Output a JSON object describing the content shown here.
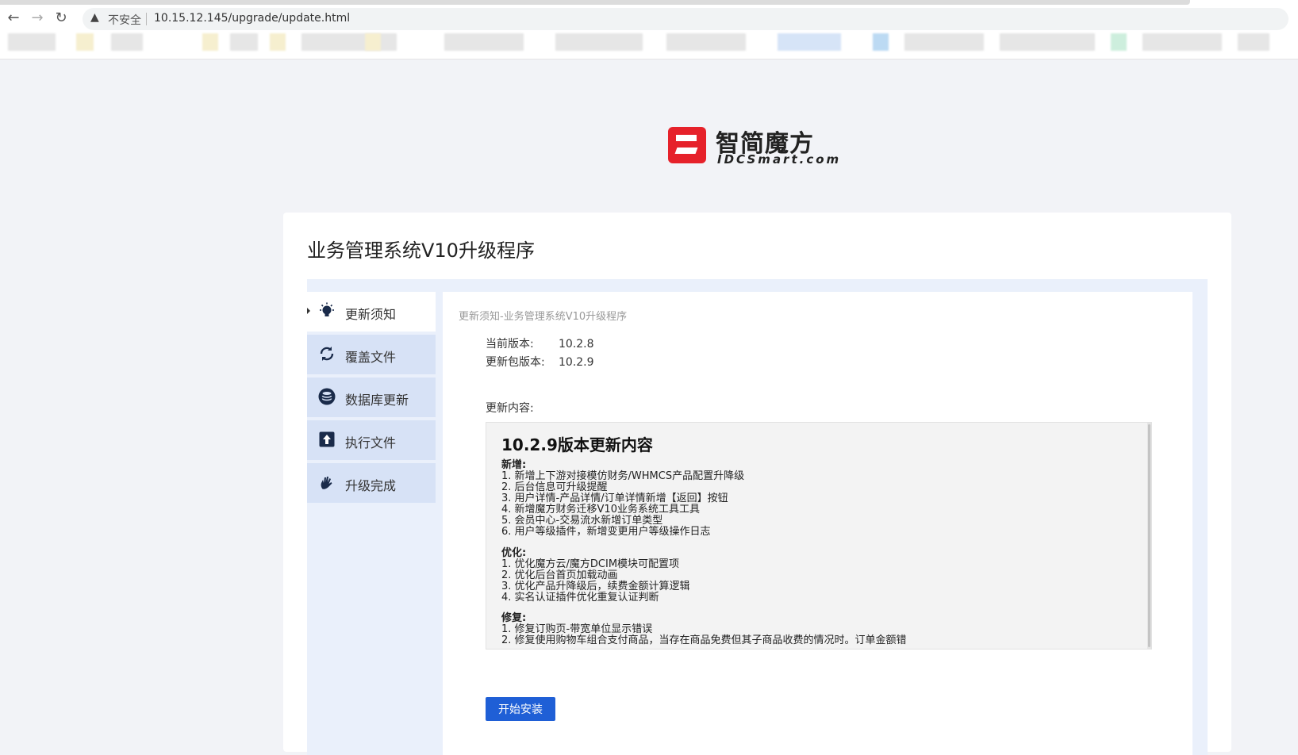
{
  "browser": {
    "insecure_label": "不安全",
    "url": "10.15.12.145/upgrade/update.html",
    "back_icon": "←",
    "forward_icon": "→",
    "reload_icon": "↻",
    "warning_icon": "▲"
  },
  "logo": {
    "name_cn": "智简魔方",
    "name_en": "IDCSmart.com",
    "brand_color": "#e6212a"
  },
  "page": {
    "title": "业务管理系统V10升级程序"
  },
  "steps": [
    {
      "label": "更新须知",
      "icon": "bulb-icon",
      "active": true
    },
    {
      "label": "覆盖文件",
      "icon": "refresh-icon",
      "active": false
    },
    {
      "label": "数据库更新",
      "icon": "database-icon",
      "active": false
    },
    {
      "label": "执行文件",
      "icon": "upload-icon",
      "active": false
    },
    {
      "label": "升级完成",
      "icon": "hand-icon",
      "active": false
    }
  ],
  "content": {
    "breadcrumb": "更新须知-业务管理系统V10升级程序",
    "current_version_label": "当前版本:",
    "current_version": "10.2.8",
    "package_version_label": "更新包版本:",
    "package_version": "10.2.9",
    "notes_label": "更新内容:",
    "notes_title": "10.2.9版本更新内容",
    "sections": [
      {
        "heading": "新增:",
        "items": [
          "1. 新增上下游对接模仿财务/WHMCS产品配置升降级",
          "2. 后台信息可升级提醒",
          "3. 用户详情-产品详情/订单详情新增【返回】按钮",
          "4. 新增魔方财务迁移V10业务系统工具工具",
          "5. 会员中心-交易流水新增订单类型",
          "6. 用户等级插件，新增变更用户等级操作日志"
        ]
      },
      {
        "heading": "优化:",
        "items": [
          "1. 优化魔方云/魔方DCIM模块可配置项",
          "2. 优化后台首页加载动画",
          "3. 优化产品升降级后，续费金额计算逻辑",
          "4. 实名认证插件优化重复认证判断"
        ]
      },
      {
        "heading": "修复:",
        "items": [
          "1. 修复订购页-带宽单位显示错误",
          "2. 修复使用购物车组合支付商品，当存在商品免费但其子商品收费的情况时。订单金额错"
        ]
      }
    ],
    "start_button": "开始安装",
    "button_color": "#1f5fd6"
  }
}
